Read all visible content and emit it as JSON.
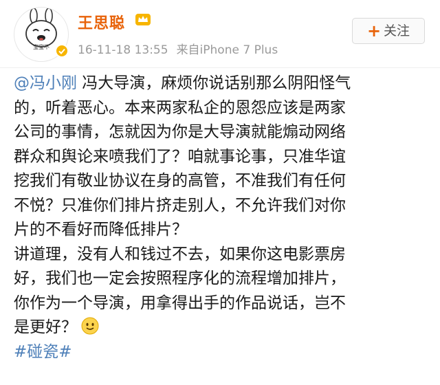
{
  "header": {
    "username": "王思聪",
    "timestamp": "16-11-18 13:55",
    "source": "来自iPhone 7 Plus",
    "avatar_caption": "宝宝不",
    "follow_label": "关注",
    "follow_icon": "plus-icon",
    "vip_icon": "crown-icon",
    "verified_icon": "verified-badge-icon"
  },
  "post": {
    "mention": "@冯小刚",
    "line1_rest": " 冯大导演，麻烦你说话别那么阴阳怪气",
    "lines": [
      "的，听着恶心。本来两家私企的恩怨应该是两家",
      "公司的事情，怎就因为你是大导演就能煽动网络",
      "群众和舆论来喷我们了？咱就事论事，只准华谊",
      "挖我们有敬业协议在身的高管，不准我们有任何",
      "不悦？只准你们排片挤走别人，不允许我们对你",
      "片的不看好而降低排片？",
      "讲道理，没有人和钱过不去，如果你这电影票房",
      "好，我们也一定会按照程序化的流程增加排片，",
      "你作为一个导演，用拿得出手的作品说话，岂不"
    ],
    "last_line": "是更好？",
    "emoji": "smile-emoji-icon",
    "hashtag": "#碰瓷#"
  },
  "colors": {
    "username": "#e8630a",
    "link": "#4d7fb8",
    "meta": "#9a9a9a",
    "text": "#1a1a1a"
  }
}
